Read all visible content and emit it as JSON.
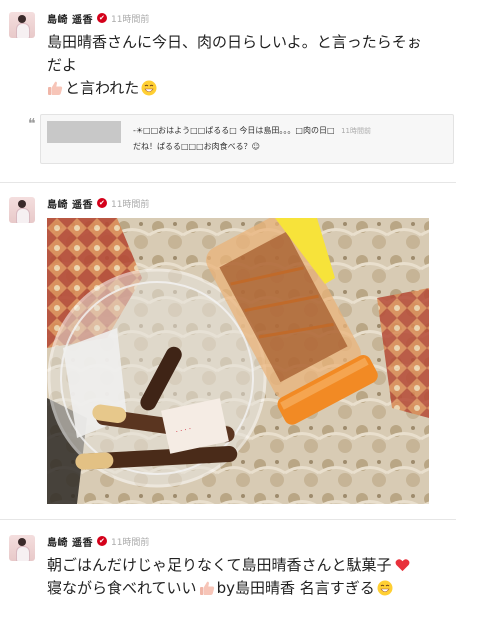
{
  "posts": [
    {
      "author": "島崎 遥香",
      "time": "11時間前",
      "line1": "島田晴香さんに今日、肉の日らしいよ。と言ったらそぉ",
      "line2": "だよ",
      "line3": "と言われた",
      "quote": {
        "text": "-☀□□おはよう□□ぱるる□ 今日は島田。。。□肉の日□",
        "text2": "だね！ぱるる□□□お肉食べる？☺",
        "time": "11時間前"
      }
    },
    {
      "author": "島崎 遥香",
      "time": "11時間前"
    },
    {
      "author": "島崎 遥香",
      "time": "11時間前",
      "line1": "朝ごはんだけじゃ足りなくて島田晴香さんと駄菓子",
      "line2_pre": "寝ながら食べれていい",
      "line2_post": "by島田晴香 名言すぎる"
    }
  ],
  "icons": {
    "verified": "verified-badge-icon",
    "thumbs_up": "thumbs-up-icon",
    "grin": "grinning-face-icon",
    "heart": "heart-icon",
    "quote": "quote-icon"
  },
  "colors": {
    "verified": "#d4001a",
    "time": "#aaaaaa",
    "quote_bg": "#f7f7f7"
  }
}
